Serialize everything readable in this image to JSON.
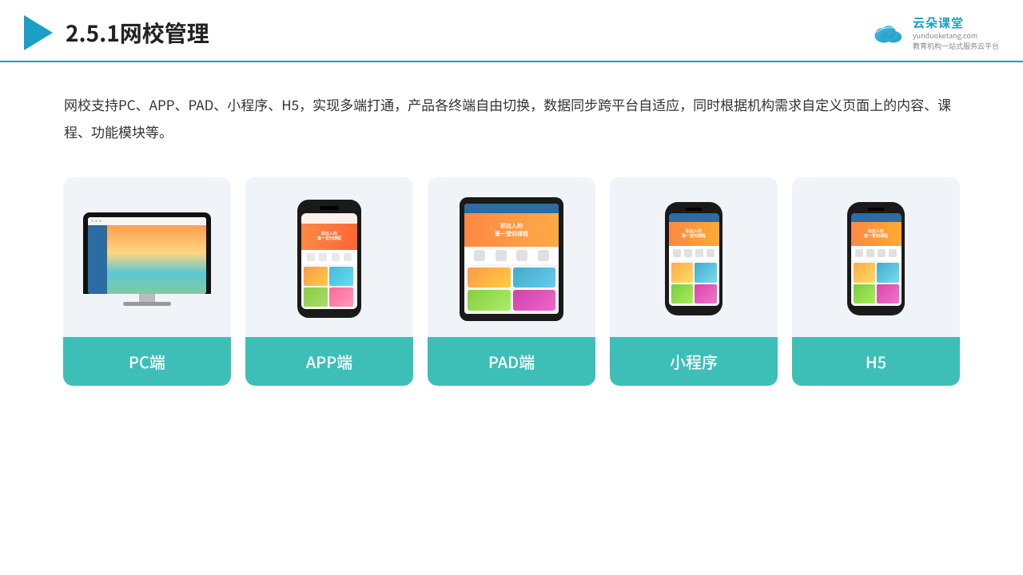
{
  "header": {
    "title": "2.5.1网校管理",
    "logo": {
      "name": "云朵课堂",
      "domain": "yunduoketang.com",
      "tagline": "教育机构一站式服务云平台"
    }
  },
  "description": "网校支持PC、APP、PAD、小程序、H5，实现多端打通，产品各终端自由切换，数据同步跨平台自适应，同时根据机构需求自定义页面上的内容、课程、功能模块等。",
  "cards": [
    {
      "id": "pc",
      "label": "PC端"
    },
    {
      "id": "app",
      "label": "APP端"
    },
    {
      "id": "pad",
      "label": "PAD端"
    },
    {
      "id": "mini",
      "label": "小程序"
    },
    {
      "id": "h5",
      "label": "H5"
    }
  ],
  "banner_text": {
    "line1": "职达人的",
    "line2": "第一堂归课程"
  }
}
